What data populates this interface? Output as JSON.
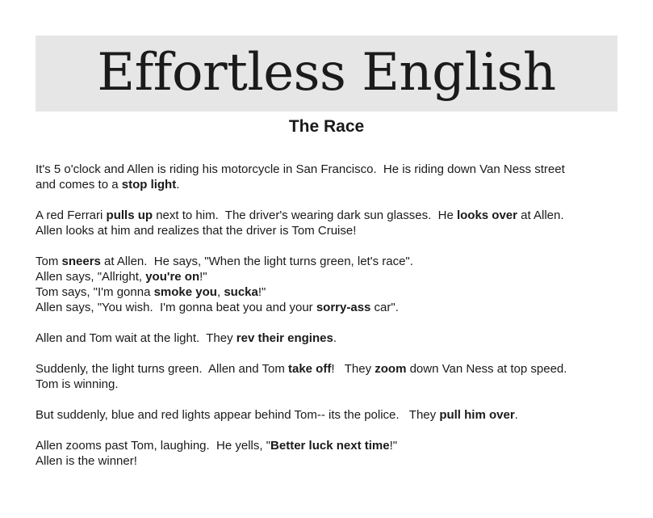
{
  "header": {
    "banner_title": "Effortless English"
  },
  "story": {
    "title": "The Race",
    "paragraphs": [
      {
        "lines": [
          [
            {
              "t": "It's 5 o'clock and Allen is riding his motorcycle in San Francisco.  He is riding down Van Ness street"
            }
          ],
          [
            {
              "t": "and comes to a "
            },
            {
              "t": "stop light",
              "b": true
            },
            {
              "t": "."
            }
          ]
        ]
      },
      {
        "lines": [
          [
            {
              "t": "A red Ferrari "
            },
            {
              "t": "pulls up",
              "b": true
            },
            {
              "t": " next to him.  The driver's wearing dark sun glasses.  He "
            },
            {
              "t": "looks over",
              "b": true
            },
            {
              "t": " at Allen."
            }
          ],
          [
            {
              "t": "Allen looks at him and realizes that the driver is Tom Cruise!"
            }
          ]
        ]
      },
      {
        "lines": [
          [
            {
              "t": "Tom "
            },
            {
              "t": "sneers",
              "b": true
            },
            {
              "t": " at Allen.  He says, \"When the light turns green, let's race\"."
            }
          ],
          [
            {
              "t": "Allen says, \"Allright, "
            },
            {
              "t": "you're on",
              "b": true
            },
            {
              "t": "!\""
            }
          ],
          [
            {
              "t": "Tom says, \"I'm gonna "
            },
            {
              "t": "smoke you",
              "b": true
            },
            {
              "t": ", "
            },
            {
              "t": "sucka",
              "b": true
            },
            {
              "t": "!\""
            }
          ],
          [
            {
              "t": "Allen says, \"You wish.  I'm gonna beat you and your "
            },
            {
              "t": "sorry-ass",
              "b": true
            },
            {
              "t": " car\"."
            }
          ]
        ]
      },
      {
        "lines": [
          [
            {
              "t": "Allen and Tom wait at the light.  They "
            },
            {
              "t": "rev their engines",
              "b": true
            },
            {
              "t": "."
            }
          ]
        ]
      },
      {
        "lines": [
          [
            {
              "t": "Suddenly, the light turns green.  Allen and Tom "
            },
            {
              "t": "take off",
              "b": true
            },
            {
              "t": "!   They "
            },
            {
              "t": "zoom",
              "b": true
            },
            {
              "t": " down Van Ness at top speed."
            }
          ],
          [
            {
              "t": "Tom is winning."
            }
          ]
        ]
      },
      {
        "lines": [
          [
            {
              "t": "But suddenly, blue and red lights appear behind Tom-- its the police.   They "
            },
            {
              "t": "pull him over",
              "b": true
            },
            {
              "t": "."
            }
          ]
        ]
      },
      {
        "lines": [
          [
            {
              "t": "Allen zooms past Tom, laughing.  He yells, \""
            },
            {
              "t": "Better luck next time",
              "b": true
            },
            {
              "t": "!\""
            }
          ],
          [
            {
              "t": "Allen is the winner!"
            }
          ]
        ]
      }
    ]
  }
}
